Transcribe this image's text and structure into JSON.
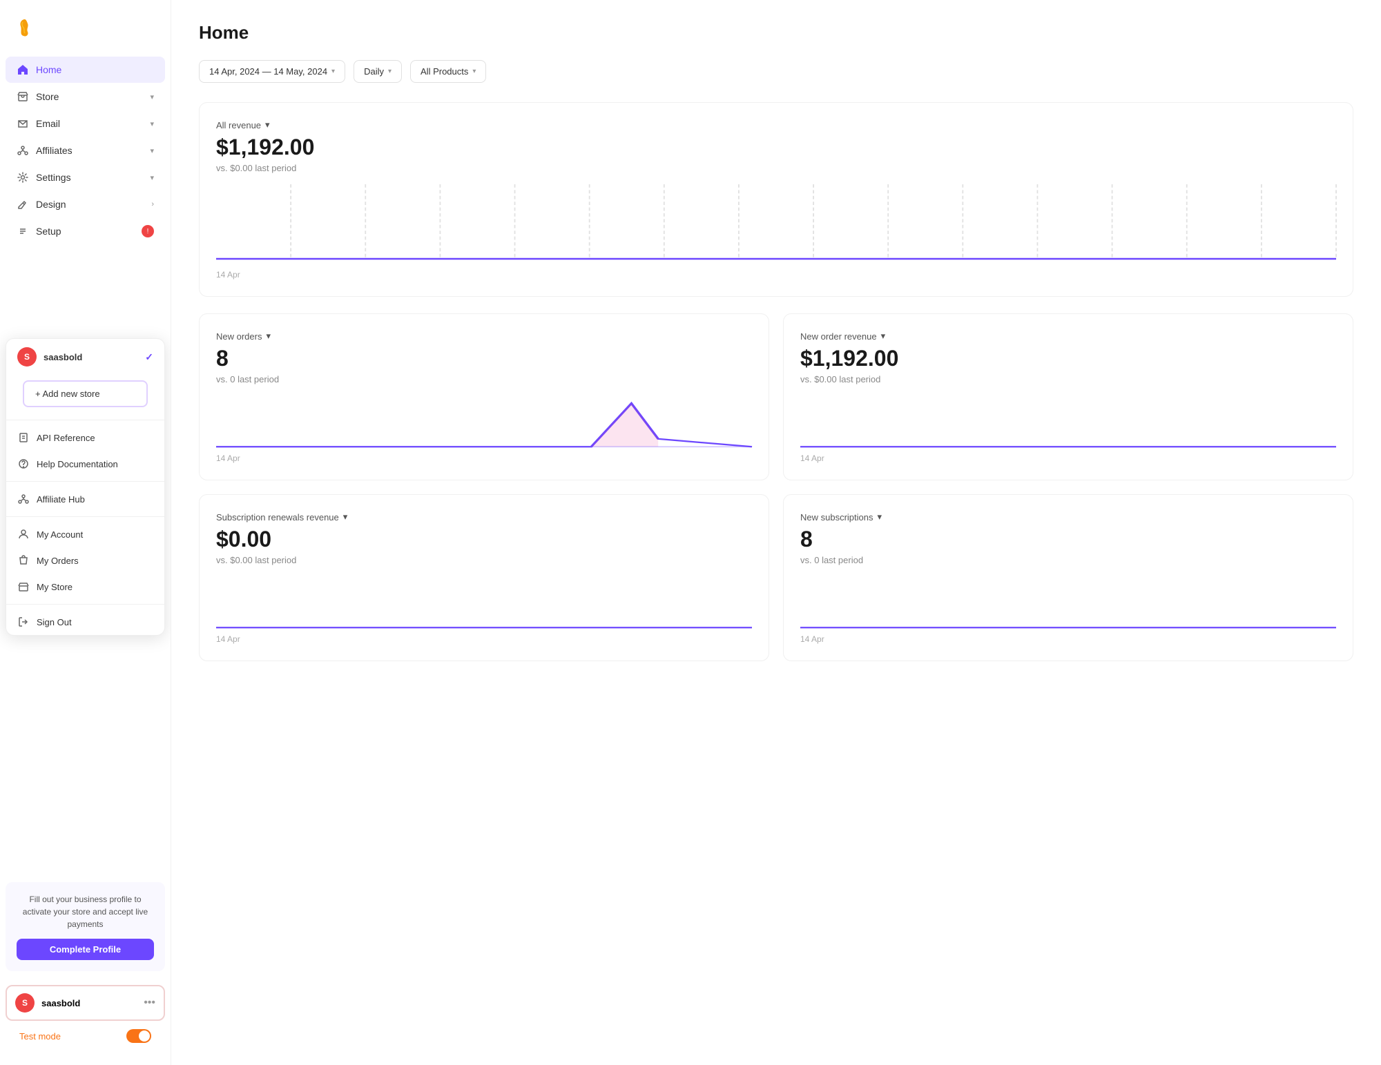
{
  "sidebar": {
    "logo_alt": "App logo",
    "nav_items": [
      {
        "id": "home",
        "label": "Home",
        "icon": "home",
        "active": true,
        "has_chevron": false
      },
      {
        "id": "store",
        "label": "Store",
        "icon": "store",
        "active": false,
        "has_chevron": true
      },
      {
        "id": "email",
        "label": "Email",
        "icon": "email",
        "active": false,
        "has_chevron": true
      },
      {
        "id": "affiliates",
        "label": "Affiliates",
        "icon": "affiliates",
        "active": false,
        "has_chevron": true
      },
      {
        "id": "settings",
        "label": "Settings",
        "icon": "settings",
        "active": false,
        "has_chevron": true
      },
      {
        "id": "design",
        "label": "Design",
        "icon": "design",
        "active": false,
        "has_chevron": true,
        "arrow": true
      },
      {
        "id": "setup",
        "label": "Setup",
        "icon": "setup",
        "active": false,
        "has_badge": true
      }
    ],
    "promo_text": "Fill out your business profile to activate your store and accept live payments",
    "promo_btn": "Complete Profile",
    "dropdown": {
      "current_store": "saasbold",
      "add_store_label": "+ Add new store",
      "menu_items": [
        {
          "id": "api",
          "label": "API Reference",
          "icon": "book"
        },
        {
          "id": "help",
          "label": "Help Documentation",
          "icon": "help"
        },
        {
          "id": "affiliate_hub",
          "label": "Affiliate Hub",
          "icon": "affiliates"
        },
        {
          "id": "my_account",
          "label": "My Account",
          "icon": "person"
        },
        {
          "id": "my_orders",
          "label": "My Orders",
          "icon": "bag"
        },
        {
          "id": "my_store",
          "label": "My Store",
          "icon": "store_small"
        },
        {
          "id": "sign_out",
          "label": "Sign Out",
          "icon": "signout"
        }
      ]
    },
    "user": {
      "name": "saasbold",
      "avatar_letter": "S"
    },
    "test_mode_label": "Test mode"
  },
  "header": {
    "title": "Home",
    "date_range": "14 Apr, 2024 — 14 May, 2024",
    "period": "Daily",
    "product_filter": "All Products"
  },
  "main": {
    "all_revenue": {
      "label": "All revenue",
      "value": "$1,192.00",
      "compare": "vs. $0.00 last period",
      "date": "14 Apr"
    },
    "new_orders": {
      "label": "New orders",
      "value": "8",
      "compare": "vs. 0 last period",
      "date": "14 Apr"
    },
    "new_order_revenue": {
      "label": "New order revenue",
      "value": "$1,192.00",
      "compare": "vs. $0.00 last period",
      "date": "14 Apr"
    },
    "subscription_renewals": {
      "label": "Subscription renewals revenue",
      "value": "$0.00",
      "compare": "vs. $0.00 last period",
      "date": "14 Apr"
    },
    "new_subscriptions": {
      "label": "New subscriptions",
      "value": "8",
      "compare": "vs. 0 last period",
      "date": "14 Apr"
    }
  }
}
